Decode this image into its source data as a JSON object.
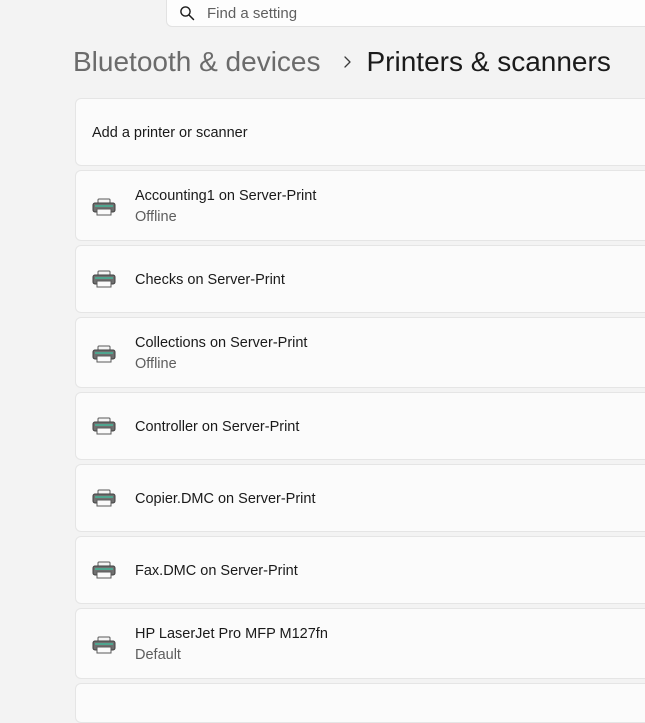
{
  "search": {
    "placeholder": "Find a setting",
    "icon": "search-icon"
  },
  "breadcrumb": {
    "parent": "Bluetooth & devices",
    "separator_icon": "chevron-right-icon",
    "current": "Printers & scanners"
  },
  "add_card": {
    "label": "Add a printer or scanner"
  },
  "printers": [
    {
      "name": "Accounting1 on Server-Print",
      "status": "Offline",
      "icon": "printer-icon"
    },
    {
      "name": "Checks on Server-Print",
      "status": "",
      "icon": "printer-icon"
    },
    {
      "name": "Collections on Server-Print",
      "status": "Offline",
      "icon": "printer-icon"
    },
    {
      "name": "Controller on Server-Print",
      "status": "",
      "icon": "printer-icon"
    },
    {
      "name": "Copier.DMC on Server-Print",
      "status": "",
      "icon": "printer-icon"
    },
    {
      "name": "Fax.DMC on Server-Print",
      "status": "",
      "icon": "printer-icon"
    },
    {
      "name": "HP LaserJet Pro MFP M127fn",
      "status": "Default",
      "icon": "printer-icon"
    }
  ],
  "colors": {
    "background": "#f3f3f3",
    "card": "#fbfbfb",
    "card_border": "#e5e5e5",
    "secondary_text": "#5d5d5d",
    "printer_accent": "#4fa58f"
  }
}
